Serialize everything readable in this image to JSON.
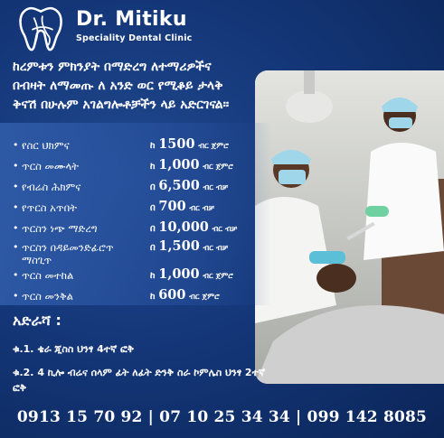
{
  "brand": {
    "name": "Dr. Mitiku",
    "subtitle": "Speciality Dental Clinic"
  },
  "headline": [
    "ከረምቱን ምክንያት በማድረግ ለተማሪዎችና",
    "በብዛት ለማመጡ ለ አንድ ወር የሚቆይ ታላቅ",
    "ቅናሽ በሁሉም አገልግሎቶቻችን ላይ አድርገናል።"
  ],
  "services": [
    {
      "name": "የስር ህክምና",
      "pre": "ከ",
      "price": "1500",
      "post": "ብር ጀምሮ"
    },
    {
      "name": "ጥርስ መሙላት",
      "pre": "ከ",
      "price": "1,000",
      "post": "ብር ጀምሮ"
    },
    {
      "name": "የብሬስ ሕክምና",
      "pre": "በ",
      "price": "6,500",
      "post": "ብር ብቻ"
    },
    {
      "name": "የጥርስ አጥበት",
      "pre": "በ",
      "price": "700",
      "post": "ብር ብቻ"
    },
    {
      "name": "ጥርስን ነጭ ማድረግ",
      "pre": "በ",
      "price": "10,000",
      "post": "ብር ብቻ"
    },
    {
      "name": "ጥርስን በዳይመንድፊሮጥ ማስጊጥ",
      "pre": "በ",
      "price": "1,500",
      "post": "ብር ብቻ"
    },
    {
      "name": "ጥርስ መተከል",
      "pre": "ከ",
      "price": "1,000",
      "post": "ብር ጀምሮ"
    },
    {
      "name": "ጥርስ መንቅል",
      "pre": "ከ",
      "price": "600",
      "post": "ብር ጀምሮ"
    }
  ],
  "address": {
    "title": "አድራሻ :",
    "branch1": "ቁ.1. ቄራ ጂስስ ህንፃ 4ተኛ ፎቅ",
    "branch2": "ቁ.2. 4 ኪሎ ብሬና ሰላም ፊት ለፊት ድንቅ ስራ ኮምሌስ ህንፃ 2ተኛ ፎቅ"
  },
  "phones": "0913 15 70 92 | 07 10 25 34 34 | 099 142 8085",
  "colors": {
    "background": "#143779",
    "panel": "#3462b1",
    "text": "#ffffff"
  }
}
